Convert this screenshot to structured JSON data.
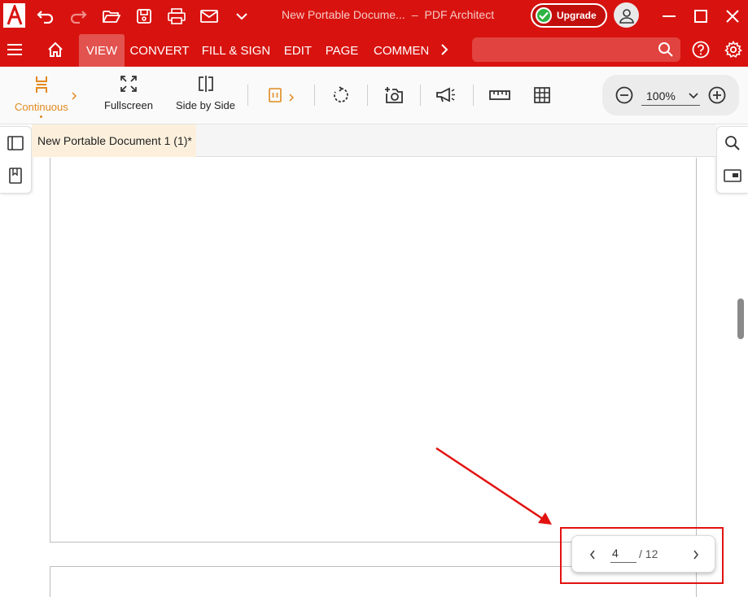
{
  "titlebar": {
    "doc_title": "New Portable Docume...",
    "separator": "–",
    "app_name": "PDF Architect",
    "upgrade_label": "Upgrade"
  },
  "ribbon": {
    "tabs": [
      {
        "label": "VIEW",
        "active": true
      },
      {
        "label": "CONVERT"
      },
      {
        "label": "FILL & SIGN"
      },
      {
        "label": "EDIT"
      },
      {
        "label": "PAGE"
      },
      {
        "label": "COMMENT"
      }
    ]
  },
  "toolbar": {
    "continuous_label": "Continuous",
    "fullscreen_label": "Fullscreen",
    "side_by_side_label": "Side by Side",
    "zoom_value": "100%"
  },
  "document": {
    "tab_title": "New Portable Document 1 (1)*"
  },
  "pager": {
    "current_page": "4",
    "total": "/ 12"
  },
  "colors": {
    "brand_red": "#d8130f",
    "active_orange": "#e2891e",
    "upgrade_green": "#2fb344",
    "annotation_red": "#e2120f"
  }
}
